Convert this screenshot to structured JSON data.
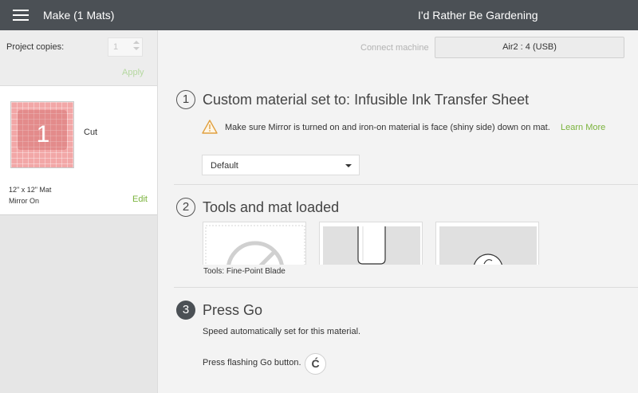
{
  "header": {
    "title": "Make (1 Mats)",
    "project_name": "I'd Rather Be Gardening"
  },
  "left": {
    "copies_label": "Project copies:",
    "copies_value": "1",
    "apply_label": "Apply",
    "mat": {
      "number": "1",
      "action": "Cut",
      "size": "12\" x 12\" Mat",
      "mirror": "Mirror On",
      "edit_label": "Edit"
    }
  },
  "machine": {
    "connect_label": "Connect machine",
    "selected": "Air2 : 4 (USB)"
  },
  "steps": [
    {
      "number": "1",
      "title": "Custom material set to: Infusible Ink Transfer Sheet",
      "warning": "Make sure Mirror is turned on and iron-on material is face (shiny side) down on mat.",
      "learn_more": "Learn More",
      "pressure_value": "Default"
    },
    {
      "number": "2",
      "title": "Tools and mat loaded",
      "tools_label": "Tools: Fine-Point Blade"
    },
    {
      "number": "3",
      "title": "Press Go",
      "desc": "Speed automatically set for this material.",
      "go_text": "Press flashing Go button."
    }
  ],
  "colors": {
    "header_bg": "#4b5055",
    "accent": "#7bb33d",
    "mat_pink": "#f2a7a7"
  }
}
